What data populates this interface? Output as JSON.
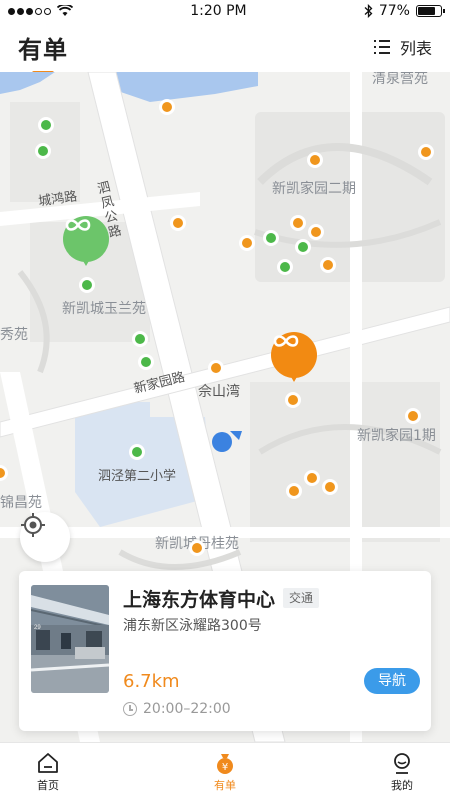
{
  "status": {
    "time": "1:20 PM",
    "battery": "77%",
    "battery_level": 0.77
  },
  "header": {
    "title": "有单",
    "list_label": "列表"
  },
  "map": {
    "labels": {
      "qingquan": "清泉营苑",
      "xinkai2": "新凯家园二期",
      "chenghong": "城鸿路",
      "sifeng": "泗凤公路",
      "yulan": "新凯城玉兰苑",
      "xiuyuan": "秀苑",
      "xinjia": "新家园路",
      "sheshan": "佘山湾",
      "xinkai1": "新凯家园1期",
      "school": "泗泾第二小学",
      "jinchang": "锦昌苑",
      "danhui": "新凯城丹桂苑"
    },
    "colors": {
      "green": "#4cb849",
      "orange": "#f0961d",
      "user": "#3b82e0"
    }
  },
  "card": {
    "title": "上海东方体育中心",
    "tag": "交通",
    "address": "浦东新区泳耀路300号",
    "distance": "6.7km",
    "nav_label": "导航",
    "hours": "20:00–22:00"
  },
  "tabs": [
    {
      "label": "首页",
      "icon": "home-icon"
    },
    {
      "label": "有单",
      "icon": "money-bag-icon"
    },
    {
      "label": "我的",
      "icon": "person-icon"
    }
  ]
}
